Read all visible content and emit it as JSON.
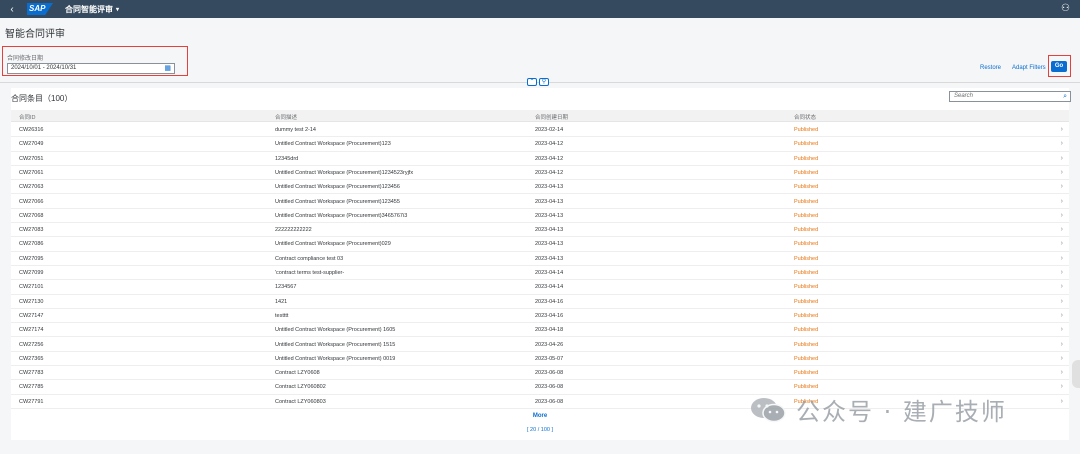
{
  "shell": {
    "back_icon": "‹",
    "logo": "SAP",
    "app_title": "合同智能评审",
    "caret": "▾",
    "user_icon": "⚇"
  },
  "page": {
    "title": "智能合同评审"
  },
  "filter": {
    "label": "合同修改日期",
    "date_value": "2024/10/01 - 2024/10/31",
    "calendar_icon": "▦"
  },
  "toolbar": {
    "restore_label": "Restore",
    "adapt_filters_label": "Adapt Filters",
    "go_label": "Go",
    "collapse_icon": "⌃",
    "pin_icon": "⚲"
  },
  "table": {
    "title": "合同条目（100）",
    "search_placeholder": "Search",
    "search_icon": "⌕",
    "columns": [
      "合同ID",
      "合同描述",
      "合同创建日期",
      "合同状态"
    ],
    "rows": [
      {
        "id": "CW26316",
        "desc": "dummy test 2-14",
        "date": "2023-02-14",
        "status": "Published"
      },
      {
        "id": "CW27049",
        "desc": "Untitled Contract Workspace (Procurement)123",
        "date": "2023-04-12",
        "status": "Published"
      },
      {
        "id": "CW27051",
        "desc": "12345drd",
        "date": "2023-04-12",
        "status": "Published"
      },
      {
        "id": "CW27061",
        "desc": "Untitled Contract Workspace (Procurement)1234523ryjfx",
        "date": "2023-04-12",
        "status": "Published"
      },
      {
        "id": "CW27063",
        "desc": "Untitled Contract Workspace (Procurement)123456",
        "date": "2023-04-13",
        "status": "Published"
      },
      {
        "id": "CW27066",
        "desc": "Untitled Contract Workspace (Procurement)123455",
        "date": "2023-04-13",
        "status": "Published"
      },
      {
        "id": "CW27068",
        "desc": "Untitled Contract Workspace (Procurement)3465767i3",
        "date": "2023-04-13",
        "status": "Published"
      },
      {
        "id": "CW27083",
        "desc": "222222222222",
        "date": "2023-04-13",
        "status": "Published"
      },
      {
        "id": "CW27086",
        "desc": "Untitled Contract Workspace (Procurement)029",
        "date": "2023-04-13",
        "status": "Published"
      },
      {
        "id": "CW27095",
        "desc": "Contract compliance test 03",
        "date": "2023-04-13",
        "status": "Published"
      },
      {
        "id": "CW27099",
        "desc": "'contract terms test-supplier-",
        "date": "2023-04-14",
        "status": "Published"
      },
      {
        "id": "CW27101",
        "desc": "1234567",
        "date": "2023-04-14",
        "status": "Published"
      },
      {
        "id": "CW27130",
        "desc": "1421",
        "date": "2023-04-16",
        "status": "Published"
      },
      {
        "id": "CW27147",
        "desc": "testttt",
        "date": "2023-04-16",
        "status": "Published"
      },
      {
        "id": "CW27174",
        "desc": "Untitled Contract Workspace (Procurement) 1605",
        "date": "2023-04-18",
        "status": "Published"
      },
      {
        "id": "CW27256",
        "desc": "Untitled Contract Workspace (Procurement) 1515",
        "date": "2023-04-26",
        "status": "Published"
      },
      {
        "id": "CW27365",
        "desc": "Untitled Contract Workspace (Procurement) 0019",
        "date": "2023-05-07",
        "status": "Published"
      },
      {
        "id": "CW27783",
        "desc": "Contract LZY0608",
        "date": "2023-06-08",
        "status": "Published"
      },
      {
        "id": "CW27785",
        "desc": "Contract LZY060802",
        "date": "2023-06-08",
        "status": "Published"
      },
      {
        "id": "CW27791",
        "desc": "Contract LZY060803",
        "date": "2023-06-08",
        "status": "Published"
      }
    ],
    "row_chevron": "›",
    "more_label": "More",
    "paging_text": "[ 20 / 100 ]"
  },
  "watermark": {
    "text": "公众号 · 建广技师"
  },
  "colors": {
    "shell_bg": "#354a5f",
    "accent": "#0a6ed1",
    "status_published": "#e9730c",
    "highlight_border": "#e5413c"
  }
}
